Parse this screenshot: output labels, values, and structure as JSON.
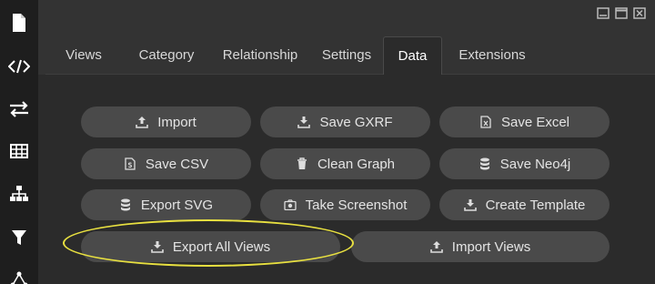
{
  "sidebar": {
    "icons": [
      "file-icon",
      "code-icon",
      "arrows-icon",
      "table-icon",
      "hierarchy-icon",
      "filter-icon",
      "network-icon"
    ]
  },
  "tabs": [
    {
      "label": "Views",
      "active": false
    },
    {
      "label": "Category",
      "active": false
    },
    {
      "label": "Relationship",
      "active": false
    },
    {
      "label": "Settings",
      "active": false
    },
    {
      "label": "Data",
      "active": true
    },
    {
      "label": "Extensions",
      "active": false
    }
  ],
  "buttons": {
    "import": {
      "label": "Import",
      "icon": "upload-icon"
    },
    "save_gxrf": {
      "label": "Save GXRF",
      "icon": "download-icon"
    },
    "save_excel": {
      "label": "Save Excel",
      "icon": "excel-file-icon"
    },
    "save_csv": {
      "label": "Save CSV",
      "icon": "csv-file-icon"
    },
    "clean_graph": {
      "label": "Clean Graph",
      "icon": "trash-icon"
    },
    "save_neo4j": {
      "label": "Save Neo4j",
      "icon": "database-icon"
    },
    "export_svg": {
      "label": "Export SVG",
      "icon": "database-icon"
    },
    "take_screenshot": {
      "label": "Take Screenshot",
      "icon": "camera-icon"
    },
    "create_template": {
      "label": "Create Template",
      "icon": "download-icon"
    },
    "export_all_views": {
      "label": "Export All Views",
      "icon": "download-icon"
    },
    "import_views": {
      "label": "Import Views",
      "icon": "upload-icon"
    }
  },
  "colors": {
    "highlight": "#e8e040",
    "button_bg": "#4a4a4a",
    "sidebar_bg": "#1e1e1e"
  }
}
